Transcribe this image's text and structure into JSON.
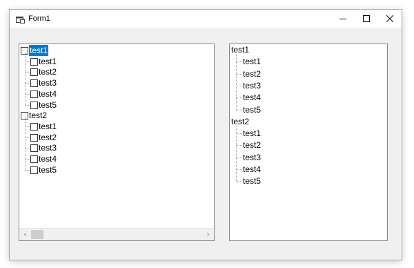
{
  "window": {
    "title": "Form1",
    "icon": "form-app-icon",
    "caption_buttons": [
      "minimize-icon",
      "maximize-icon",
      "close-icon"
    ]
  },
  "left_tree": {
    "checkboxes": true,
    "selected_label": "test1",
    "parents": [
      {
        "label": "test1",
        "children": [
          "test1",
          "test2",
          "test3",
          "test4",
          "test5"
        ]
      },
      {
        "label": "test2",
        "children": [
          "test1",
          "test2",
          "test3",
          "test4",
          "test5"
        ]
      }
    ],
    "hscroll": {
      "left_arrow": "‹",
      "right_arrow": "›",
      "position": 0
    }
  },
  "right_tree": {
    "checkboxes": false,
    "parents": [
      {
        "label": "test1",
        "children": [
          "test1",
          "test2",
          "test3",
          "test4",
          "test5"
        ]
      },
      {
        "label": "test2",
        "children": [
          "test1",
          "test2",
          "test3",
          "test4",
          "test5"
        ]
      }
    ]
  },
  "colors": {
    "selection": "#0078d7",
    "window_bg": "#f0f0f0",
    "tree_bg": "#ffffff",
    "tree_border": "#828790"
  }
}
